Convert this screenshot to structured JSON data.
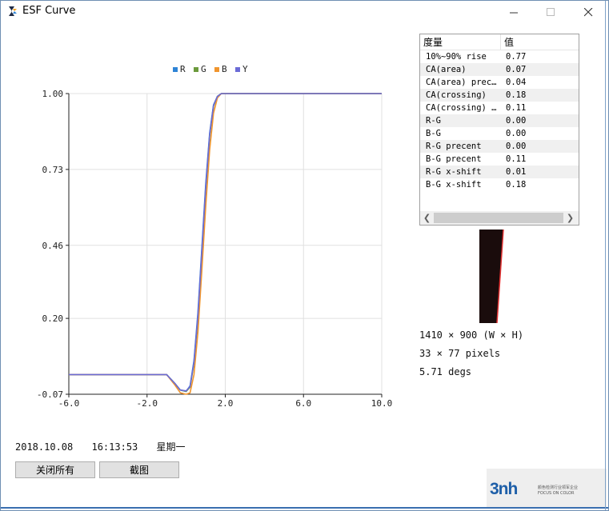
{
  "window": {
    "title": "ESF Curve"
  },
  "chart_data": {
    "type": "line",
    "xlim": [
      -6.0,
      10.0
    ],
    "ylim": [
      -0.07,
      1.0
    ],
    "x_ticks": [
      "-6.0",
      "-2.0",
      "2.0",
      "6.0",
      "10.0"
    ],
    "y_ticks": [
      "1.00",
      "0.73",
      "0.46",
      "0.20",
      "-0.07"
    ],
    "grid": true,
    "legend_position": "top",
    "series": [
      {
        "name": "R",
        "color": "#2e84d6",
        "x": [
          -6.0,
          -1.0,
          -0.6,
          -0.3,
          0.0,
          0.2,
          0.4,
          0.6,
          0.8,
          1.0,
          1.2,
          1.4,
          1.6,
          1.8,
          2.0,
          2.4,
          10.0
        ],
        "y": [
          0.0,
          0.0,
          -0.03,
          -0.055,
          -0.06,
          -0.04,
          0.05,
          0.22,
          0.45,
          0.68,
          0.86,
          0.96,
          0.99,
          1.0,
          1.0,
          1.0,
          1.0
        ]
      },
      {
        "name": "G",
        "color": "#6b9a3c",
        "x": [
          -6.0,
          -1.0,
          -0.6,
          -0.3,
          0.0,
          0.2,
          0.4,
          0.6,
          0.8,
          1.0,
          1.2,
          1.4,
          1.6,
          1.8,
          2.0,
          2.4,
          10.0
        ],
        "y": [
          0.0,
          0.0,
          -0.03,
          -0.055,
          -0.06,
          -0.045,
          0.04,
          0.2,
          0.43,
          0.66,
          0.85,
          0.955,
          0.99,
          1.0,
          1.0,
          1.0,
          1.0
        ]
      },
      {
        "name": "B",
        "color": "#f0952e",
        "x": [
          -6.0,
          -1.0,
          -0.6,
          -0.3,
          0.0,
          0.2,
          0.4,
          0.6,
          0.8,
          1.0,
          1.2,
          1.4,
          1.6,
          1.8,
          2.0,
          2.4,
          10.0
        ],
        "y": [
          0.0,
          0.0,
          -0.035,
          -0.065,
          -0.07,
          -0.065,
          0.0,
          0.15,
          0.37,
          0.6,
          0.8,
          0.93,
          0.985,
          1.0,
          1.0,
          1.0,
          1.0
        ]
      },
      {
        "name": "Y",
        "color": "#6b6bd6",
        "x": [
          -6.0,
          -1.0,
          -0.6,
          -0.3,
          0.0,
          0.2,
          0.4,
          0.6,
          0.8,
          1.0,
          1.2,
          1.4,
          1.6,
          1.8,
          2.0,
          2.4,
          10.0
        ],
        "y": [
          0.0,
          0.0,
          -0.03,
          -0.055,
          -0.058,
          -0.042,
          0.045,
          0.21,
          0.44,
          0.67,
          0.855,
          0.958,
          0.99,
          1.0,
          1.0,
          1.0,
          1.0
        ]
      }
    ]
  },
  "table": {
    "headers": [
      "度量",
      "值"
    ],
    "rows": [
      [
        "10%~90% rise",
        "0.77"
      ],
      [
        "CA(area)",
        "0.07"
      ],
      [
        "CA(area) prec…",
        "0.04"
      ],
      [
        "CA(crossing)",
        "0.18"
      ],
      [
        "CA(crossing) …",
        "0.11"
      ],
      [
        "R-G",
        "0.00"
      ],
      [
        "B-G",
        "0.00"
      ],
      [
        "R-G precent",
        "0.00"
      ],
      [
        "B-G precent",
        "0.11"
      ],
      [
        "R-G x-shift",
        "0.01"
      ],
      [
        "B-G x-shift",
        "0.18"
      ]
    ]
  },
  "info": {
    "resolution": "1410 × 900 (W × H)",
    "roi": "33 × 77 pixels",
    "angle": "5.71 degs"
  },
  "datetime": {
    "date": "2018.10.08",
    "time": "16:13:53",
    "weekday": "星期一"
  },
  "buttons": {
    "close_all": "关闭所有",
    "screenshot": "截图"
  },
  "logo": {
    "main": "3nh",
    "sub1": "颜色检测行业领军企业",
    "sub2": "FOCUS ON COLOR"
  },
  "colors": {
    "accent": "#3a6fb0",
    "edge_line": "#e03030"
  }
}
